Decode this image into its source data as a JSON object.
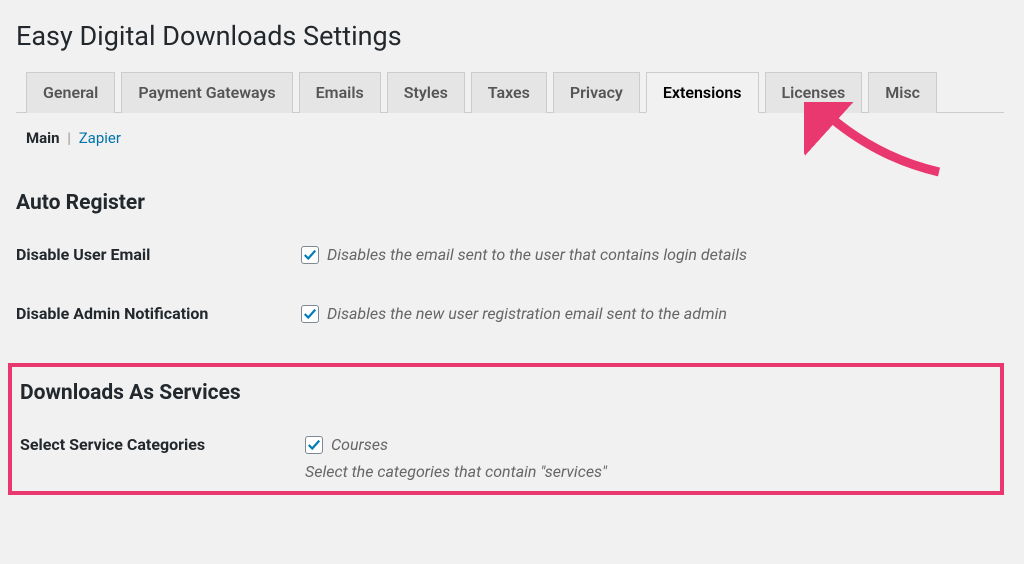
{
  "page_title": "Easy Digital Downloads Settings",
  "tabs": [
    {
      "label": "General",
      "active": false
    },
    {
      "label": "Payment Gateways",
      "active": false
    },
    {
      "label": "Emails",
      "active": false
    },
    {
      "label": "Styles",
      "active": false
    },
    {
      "label": "Taxes",
      "active": false
    },
    {
      "label": "Privacy",
      "active": false
    },
    {
      "label": "Extensions",
      "active": true
    },
    {
      "label": "Licenses",
      "active": false
    },
    {
      "label": "Misc",
      "active": false
    }
  ],
  "subtabs": {
    "active": "Main",
    "link": "Zapier"
  },
  "sections": {
    "auto_register": {
      "title": "Auto Register",
      "settings": [
        {
          "label": "Disable User Email",
          "checked": true,
          "description": "Disables the email sent to the user that contains login details"
        },
        {
          "label": "Disable Admin Notification",
          "checked": true,
          "description": "Disables the new user registration email sent to the admin"
        }
      ]
    },
    "downloads_as_services": {
      "title": "Downloads As Services",
      "settings": [
        {
          "label": "Select Service Categories",
          "checked": true,
          "option": "Courses",
          "help": "Select the categories that contain \"services\""
        }
      ]
    }
  },
  "colors": {
    "accent": "#0073aa",
    "highlight": "#e9376f",
    "check": "#007cba"
  }
}
